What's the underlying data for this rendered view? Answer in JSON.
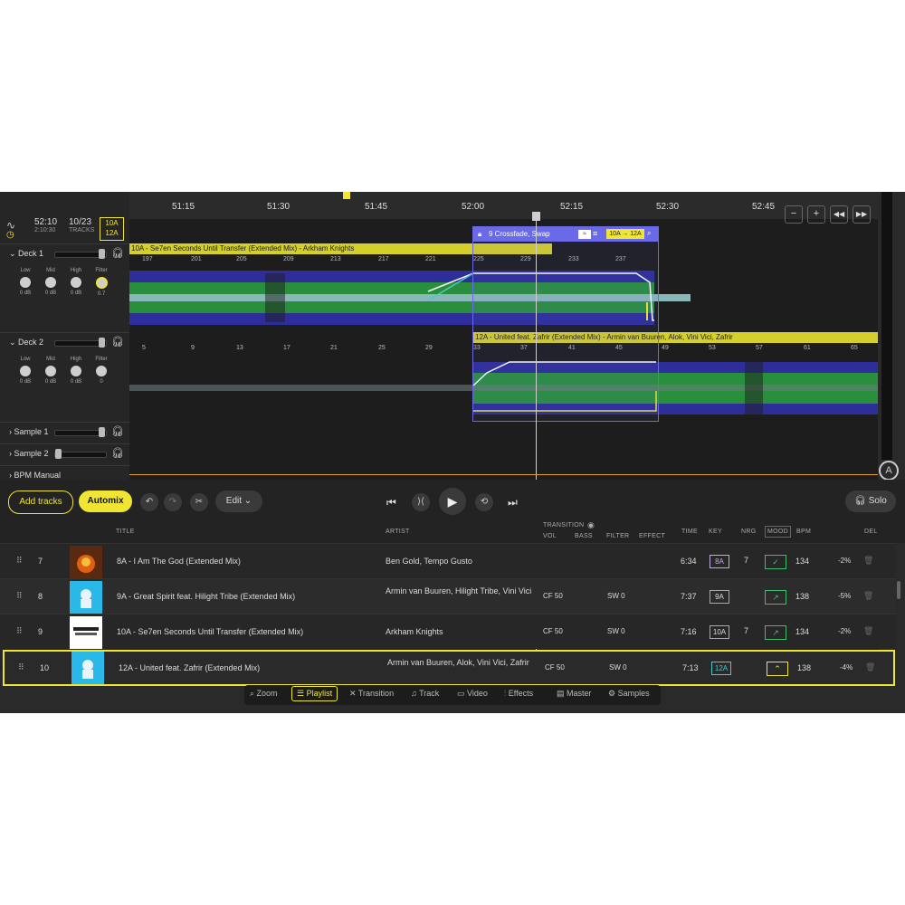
{
  "stats": {
    "time": "52:10",
    "time_sub": "2:10:30",
    "tracks": "10/23",
    "tracks_sub": "TRACKS",
    "key1": "10A",
    "key2": "12A"
  },
  "decks": {
    "deck1": "Deck 1",
    "deck2": "Deck 2",
    "sample1": "Sample 1",
    "sample2": "Sample 2",
    "bpm": "BPM Manual",
    "eq_labels": [
      "Low",
      "Mid",
      "High",
      "Filter"
    ],
    "deck1_values": [
      "0 dB",
      "0 dB",
      "0 dB",
      "0.7"
    ],
    "deck2_values": [
      "0 dB",
      "0 dB",
      "0 dB",
      "0"
    ]
  },
  "timeline": {
    "times": [
      "51:15",
      "51:30",
      "51:45",
      "52:00",
      "52:15",
      "52:30",
      "52:45"
    ],
    "track1_title": "10A - Se7en Seconds Until Transfer (Extended Mix) - Arkham Knights",
    "track2_title": "12A - United feat. Zafrir (Extended Mix) - Armin van Buuren, Alok, Vini Vici, Zafrir",
    "beats1": [
      "197",
      "201",
      "205",
      "209",
      "213",
      "217",
      "221",
      "225",
      "229",
      "233",
      "237"
    ],
    "beats2": [
      "5",
      "9",
      "13",
      "17",
      "21",
      "25",
      "29",
      "33",
      "37",
      "41",
      "45",
      "49",
      "53",
      "57",
      "61",
      "65"
    ],
    "transition_label": "9 Crossfade, Swap",
    "transition_key": "10A → 12A",
    "buttons": [
      "−",
      "+",
      "◀◀",
      "▶▶"
    ]
  },
  "transport": {
    "add_tracks": "Add tracks",
    "automix": "Automix",
    "edit": "Edit",
    "solo": "Solo"
  },
  "columns": {
    "title": "TITLE",
    "artist": "ARTIST",
    "transition": "TRANSITION",
    "vol": "VOL",
    "bass": "BASS",
    "filter": "FILTER",
    "effect": "EFFECT",
    "time": "TIME",
    "key": "KEY",
    "nrg": "NRG",
    "mood": "MOOD",
    "bpm": "BPM",
    "del": "DEL"
  },
  "rows": [
    {
      "num": "7",
      "title": "8A - I Am The God (Extended Mix)",
      "artist": "Ben Gold, Tempo Gusto",
      "vol": "",
      "filter": "",
      "time": "6:34",
      "key": "8A",
      "nrg": "7",
      "mood": "✓",
      "bpm": "134",
      "pct": "-2%"
    },
    {
      "num": "8",
      "title": "9A - Great Spirit feat. Hilight Tribe (Extended Mix)",
      "artist": "Armin van Buuren, Hilight Tribe, Vini Vici",
      "vol": "CF 50",
      "filter": "SW 0",
      "time": "7:37",
      "key": "9A",
      "nrg": "",
      "mood": "↗",
      "bpm": "138",
      "pct": "-5%"
    },
    {
      "num": "9",
      "title": "10A - Se7en Seconds Until Transfer (Extended Mix)",
      "artist": "Arkham Knights",
      "vol": "CF 50",
      "filter": "SW 0",
      "time": "7:16",
      "key": "10A",
      "nrg": "7",
      "mood": "↗",
      "bpm": "134",
      "pct": "-2%"
    },
    {
      "num": "10",
      "title": "12A - United feat. Zafrir (Extended Mix)",
      "artist": "Armin van Buuren, Alok, Vini Vici, Zafrir",
      "vol": "CF 50",
      "filter": "SW 0",
      "time": "7:13",
      "key": "12A",
      "nrg": "",
      "mood": "⌃",
      "bpm": "138",
      "pct": "-4%"
    }
  ],
  "tabs": [
    "Zoom",
    "Playlist",
    "Transition",
    "Track",
    "Video",
    "Effects",
    "Master",
    "Samples"
  ],
  "colors": {
    "accent": "#f0e533",
    "transition": "#6a6ae8",
    "mood": "#3fbf6a",
    "key_teal": "#4ec9c9"
  }
}
